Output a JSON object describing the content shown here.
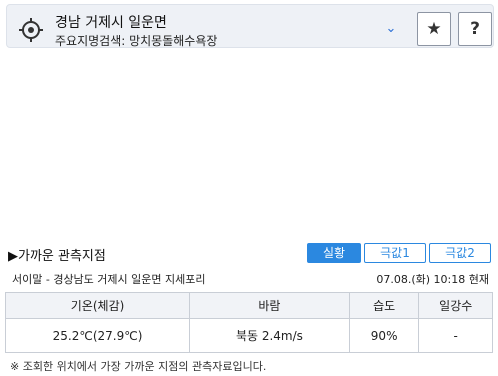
{
  "header": {
    "region": "경남 거제시 일운면",
    "search_label": "주요지명검색",
    "search_value": "망치몽돌해수욕장",
    "search_line": "주요지명검색: 망치몽돌해수욕장",
    "location_icon": "crosshair-icon",
    "dropdown_icon": "chevron-down-icon",
    "favorite_icon": "star-icon",
    "help_label": "?"
  },
  "section": {
    "title": "▶가까운 관측지점",
    "tabs": [
      {
        "label": "실황",
        "active": true
      },
      {
        "label": "극값1",
        "active": false
      },
      {
        "label": "극값2",
        "active": false
      }
    ]
  },
  "station": {
    "name": "서이말 - 경상남도 거제시 일운면 지세포리",
    "time": "07.08.(화) 10:18 현재"
  },
  "table": {
    "headers": [
      "기온(체감)",
      "바람",
      "습도",
      "일강수"
    ],
    "rows": [
      [
        "25.2℃(27.9℃)",
        "북동 2.4m/s",
        "90%",
        "-"
      ]
    ]
  },
  "note": "※ 조회한 위치에서 가장 가까운 지점의 관측자료입니다.",
  "colors": {
    "accent": "#2b88e0",
    "topbar_bg": "#eef1f6",
    "table_header_bg": "#f1f3f7"
  }
}
